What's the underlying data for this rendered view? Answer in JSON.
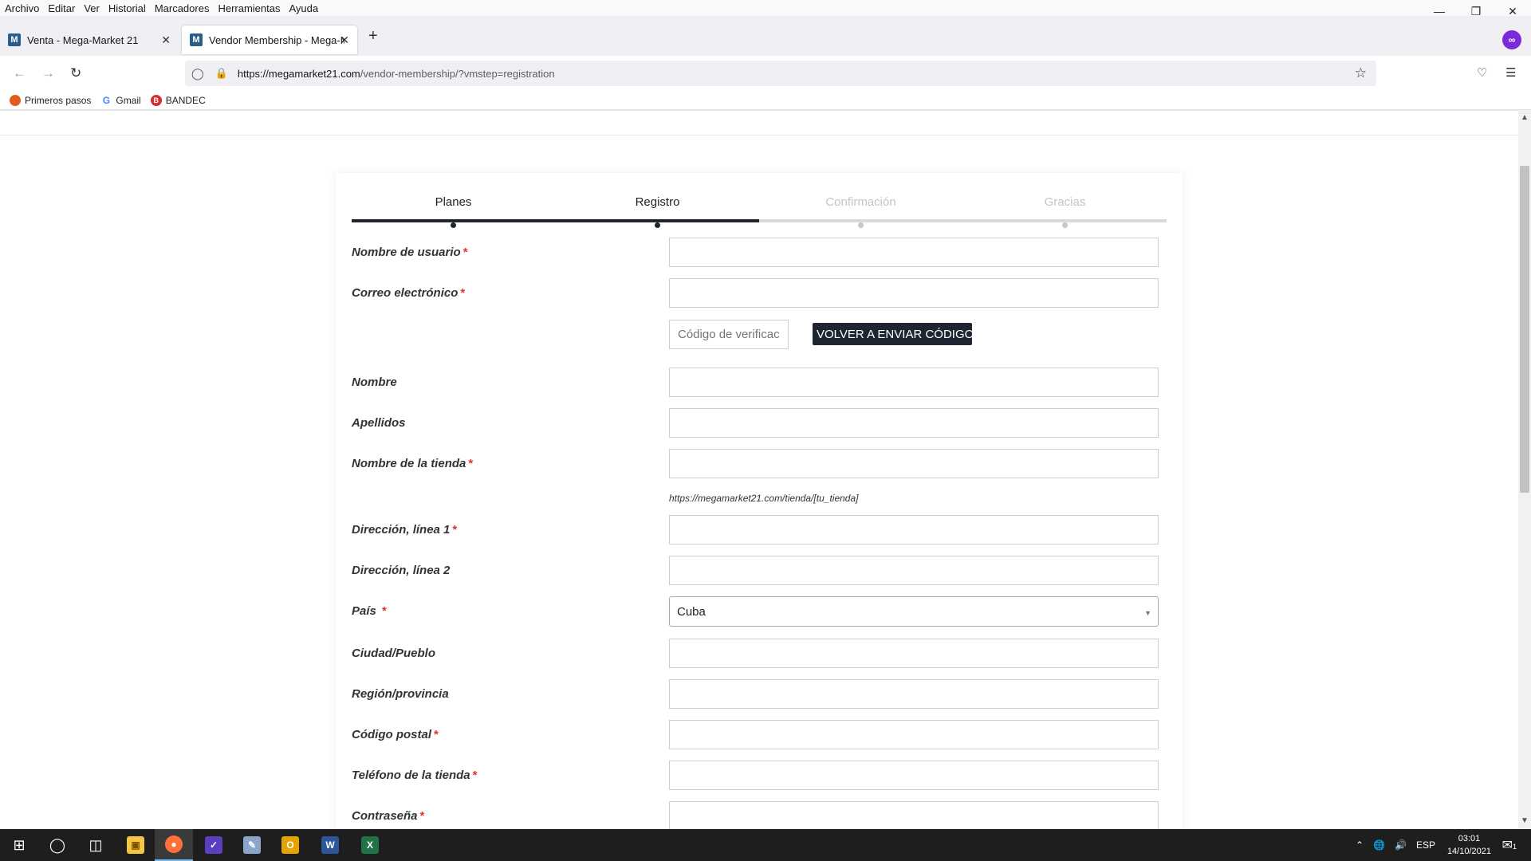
{
  "menubar": {
    "items": [
      "Archivo",
      "Editar",
      "Ver",
      "Historial",
      "Marcadores",
      "Herramientas",
      "Ayuda"
    ]
  },
  "tabs": [
    {
      "title": "Venta - Mega-Market 21",
      "favicon": "M",
      "active": false
    },
    {
      "title": "Vendor Membership - Mega-M",
      "favicon": "M",
      "active": true
    }
  ],
  "urlbar": {
    "host": "https://megamarket21.com",
    "path": "/vendor-membership/?vmstep=registration"
  },
  "bookmarks": [
    {
      "label": "Primeros pasos",
      "icon": "firefox-icon",
      "color": "#e25b1f"
    },
    {
      "label": "Gmail",
      "icon": "google-icon",
      "color": "#4285f4"
    },
    {
      "label": "BANDEC",
      "icon": "bandec-icon",
      "color": "#d32f2f"
    }
  ],
  "steps": [
    {
      "label": "Planes",
      "state": "done"
    },
    {
      "label": "Registro",
      "state": "done"
    },
    {
      "label": "Confirmación",
      "state": "todo"
    },
    {
      "label": "Gracias",
      "state": "todo"
    }
  ],
  "form": {
    "username_label": "Nombre de usuario",
    "email_label": "Correo electrónico",
    "verify_placeholder": "Código de verificación",
    "resend_label": "VOLVER A ENVIAR CÓDIGO",
    "first_name_label": "Nombre",
    "last_name_label": "Apellidos",
    "store_name_label": "Nombre de la tienda",
    "store_url_hint": "https://megamarket21.com/tienda/[tu_tienda]",
    "address1_label": "Dirección, línea 1",
    "address2_label": "Dirección, línea 2",
    "country_label": "País",
    "country_value": "Cuba",
    "city_label": "Ciudad/Pueblo",
    "region_label": "Región/provincia",
    "postcode_label": "Código postal",
    "phone_label": "Teléfono de la tienda",
    "password_label": "Contraseña",
    "required_mark": "*"
  },
  "taskbar": {
    "language": "ESP",
    "time": "03:01",
    "date": "14/10/2021",
    "notifications": "1"
  },
  "colors": {
    "accent_dark": "#1e2531",
    "required": "#e03131",
    "step_inactive": "#c4c4c4"
  }
}
